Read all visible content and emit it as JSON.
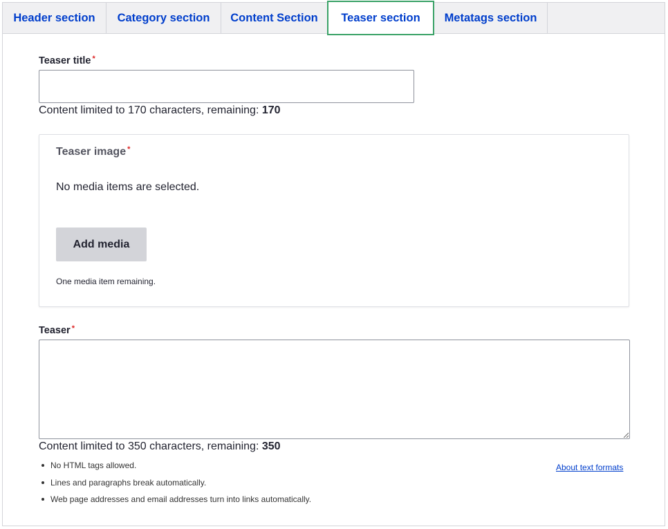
{
  "tabs": [
    {
      "label": "Header section",
      "active": false
    },
    {
      "label": "Category section",
      "active": false
    },
    {
      "label": "Content Section",
      "active": false
    },
    {
      "label": "Teaser section",
      "active": true
    },
    {
      "label": "Metatags section",
      "active": false
    }
  ],
  "teaser_title": {
    "label": "Teaser title",
    "required_mark": "*",
    "value": "",
    "counter_text": "Content limited to 170 characters, remaining: ",
    "counter_remaining": "170"
  },
  "teaser_image": {
    "label": "Teaser image",
    "required_mark": "*",
    "empty_text": "No media items are selected.",
    "add_button_label": "Add media",
    "remaining_text": "One media item remaining."
  },
  "teaser": {
    "label": "Teaser",
    "required_mark": "*",
    "value": "",
    "counter_text": "Content limited to 350 characters, remaining: ",
    "counter_remaining": "350",
    "tips": [
      "No HTML tags allowed.",
      "Lines and paragraphs break automatically.",
      "Web page addresses and email addresses turn into links automatically."
    ],
    "about_link": "About text formats"
  },
  "colors": {
    "link": "#003ecc",
    "active_tab_border": "#3aa267",
    "required": "#dc2323",
    "button_bg": "#d3d4d9"
  }
}
